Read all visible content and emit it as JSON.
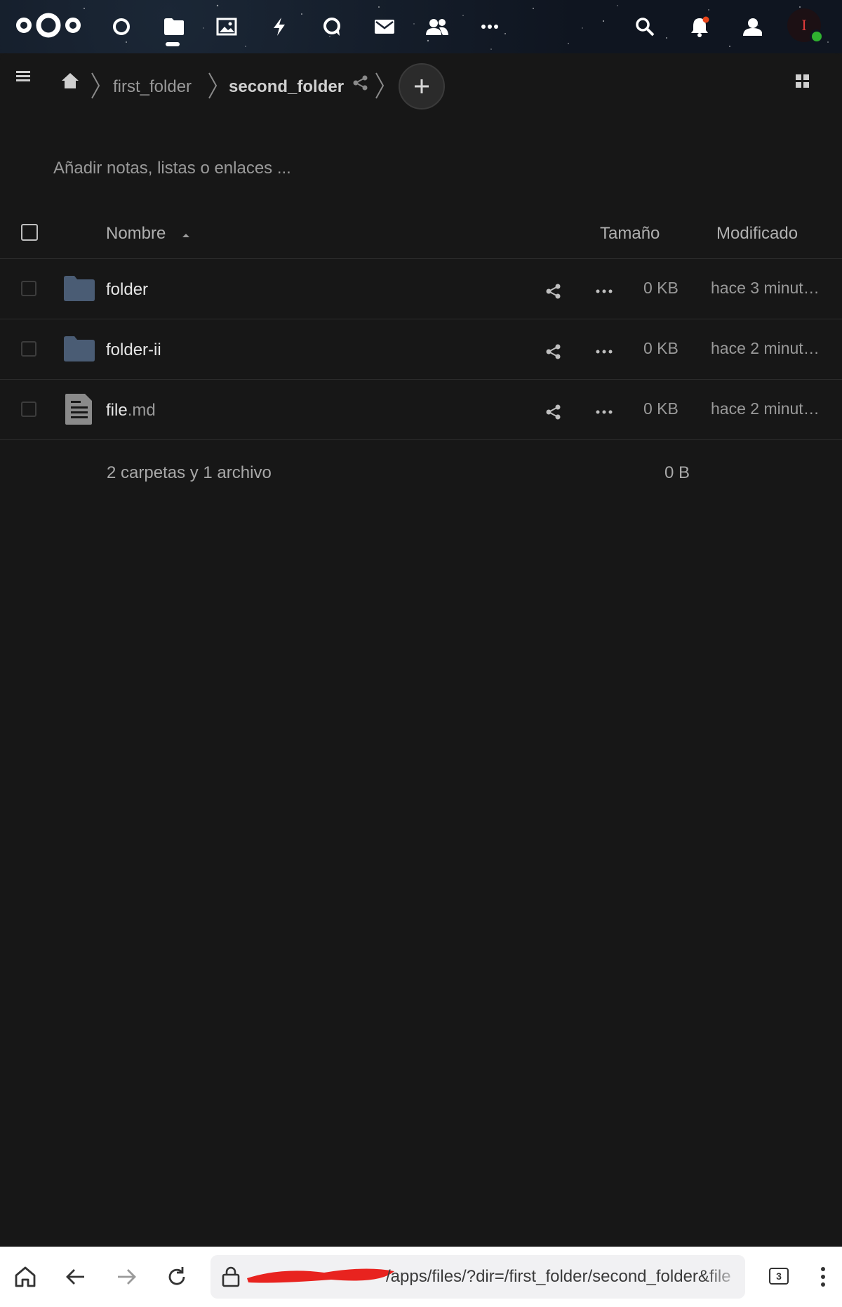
{
  "header": {
    "app_icons": [
      "nextcloud-logo-icon",
      "dashboard-icon",
      "files-icon",
      "photos-icon",
      "activity-icon",
      "talk-icon",
      "mail-icon",
      "contacts-icon",
      "more-apps-icon"
    ],
    "right_icons": [
      "search-icon",
      "notifications-icon",
      "contacts-menu-icon"
    ],
    "avatar_initial": "I",
    "status_color": "#2fb130"
  },
  "breadcrumb": {
    "items": [
      "first_folder",
      "second_folder"
    ]
  },
  "notes_placeholder": "Añadir notas, listas o enlaces ...",
  "table": {
    "columns": {
      "name": "Nombre",
      "size": "Tamaño",
      "modified": "Modificado"
    },
    "rows": [
      {
        "name": "folder",
        "ext": "",
        "type": "folder",
        "size": "0 KB",
        "modified": "hace 3 minut…"
      },
      {
        "name": "folder-ii",
        "ext": "",
        "type": "folder",
        "size": "0 KB",
        "modified": "hace 2 minut…"
      },
      {
        "name": "file",
        "ext": ".md",
        "type": "file",
        "size": "0 KB",
        "modified": "hace 2 minut…"
      }
    ],
    "summary": {
      "text": "2 carpetas y 1 archivo",
      "size": "0 B"
    }
  },
  "browser": {
    "url": "/apps/files/?dir=/first_folder/second_folder&file",
    "tab_count": "3"
  },
  "colors": {
    "folder": "#4a5c74",
    "background": "#171717",
    "redaction": "#e8231f"
  }
}
